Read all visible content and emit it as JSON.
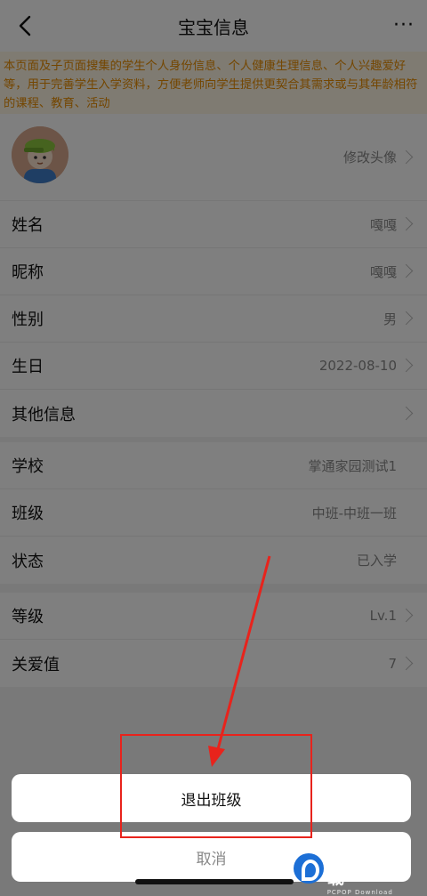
{
  "navbar": {
    "title": "宝宝信息",
    "more": "···"
  },
  "notice": {
    "text": "本页面及子页面搜集的学生个人身份信息、个人健康生理信息、个人兴趣爱好等，用于完善学生入学资料，方便老师向学生提供更契合其需求或与其年龄相符的课程、教育、活动"
  },
  "profile": {
    "avatar_label": "修改头像",
    "rows": [
      {
        "label": "姓名",
        "value": "嘎嘎"
      },
      {
        "label": "昵称",
        "value": "嘎嘎"
      },
      {
        "label": "性别",
        "value": "男"
      },
      {
        "label": "生日",
        "value": "2022-08-10"
      },
      {
        "label": "其他信息",
        "value": ""
      }
    ]
  },
  "school": {
    "rows": [
      {
        "label": "学校",
        "value": "掌通家园测试1"
      },
      {
        "label": "班级",
        "value": "中班-中班一班"
      },
      {
        "label": "状态",
        "value": "已入学"
      }
    ]
  },
  "growth": {
    "rows": [
      {
        "label": "等级",
        "value": "Lv.1"
      },
      {
        "label": "关爱值",
        "value": "7"
      }
    ]
  },
  "action_sheet": {
    "exit_label": "退出班级",
    "cancel_label": "取消"
  },
  "watermark": {
    "main": "PCPOP下载",
    "sub": "PCPOP Download"
  },
  "colors": {
    "notice_text": "#e88c00",
    "highlight": "#e8231c"
  }
}
